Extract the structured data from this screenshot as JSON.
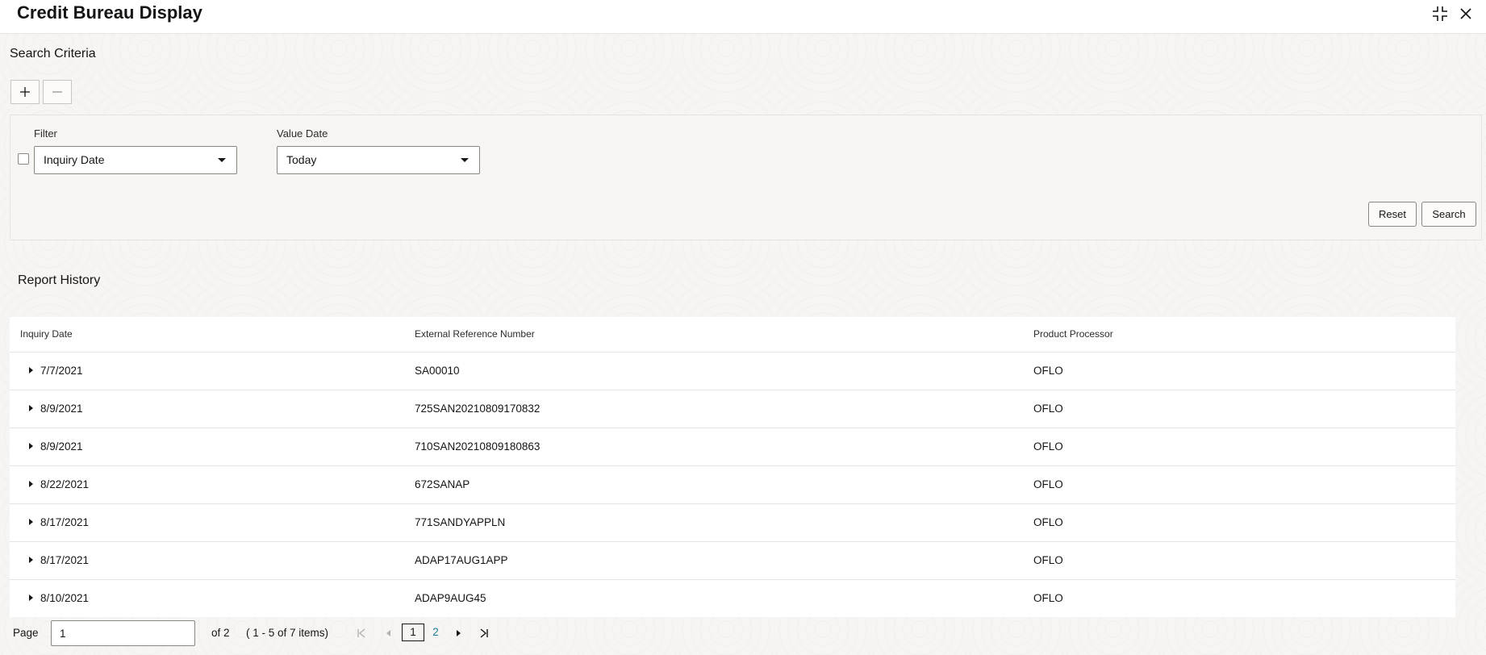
{
  "window": {
    "title": "Credit Bureau Display"
  },
  "icons": {
    "minimize": "compress-icon",
    "close": "close-icon",
    "add": "plus-icon",
    "remove": "minus-icon",
    "dropdown": "caret-down-icon",
    "expand_row": "caret-right-icon",
    "first_page": "first-page-icon",
    "prev_page": "previous-page-icon",
    "next_page": "next-page-icon",
    "last_page": "last-page-icon"
  },
  "search_criteria": {
    "heading": "Search Criteria",
    "filter": {
      "label": "Filter",
      "selected": "Inquiry Date",
      "checked": false
    },
    "value_date": {
      "label": "Value Date",
      "selected": "Today"
    },
    "reset_label": "Reset",
    "search_label": "Search"
  },
  "report_history": {
    "heading": "Report History",
    "columns": [
      "Inquiry Date",
      "External Reference Number",
      "Product Processor"
    ],
    "rows": [
      {
        "inquiry_date": "7/7/2021",
        "ext_ref": "SA00010",
        "processor": "OFLO"
      },
      {
        "inquiry_date": "8/9/2021",
        "ext_ref": "725SAN20210809170832",
        "processor": "OFLO"
      },
      {
        "inquiry_date": "8/9/2021",
        "ext_ref": "710SAN20210809180863",
        "processor": "OFLO"
      },
      {
        "inquiry_date": "8/22/2021",
        "ext_ref": "672SANAP",
        "processor": "OFLO"
      },
      {
        "inquiry_date": "8/17/2021",
        "ext_ref": "771SANDYAPPLN",
        "processor": "OFLO"
      },
      {
        "inquiry_date": "8/17/2021",
        "ext_ref": "ADAP17AUG1APP",
        "processor": "OFLO"
      },
      {
        "inquiry_date": "8/10/2021",
        "ext_ref": "ADAP9AUG45",
        "processor": "OFLO"
      }
    ]
  },
  "pagination": {
    "page_label": "Page",
    "page_value": "1",
    "of_label": "of 2",
    "items_label": "( 1 - 5 of 7 items)",
    "pages": [
      "1",
      "2"
    ],
    "current_page": "1",
    "colors": {
      "current_border": "#161513",
      "link": "#227e9e"
    }
  },
  "colors": {
    "text": "#161513",
    "panel_bg": "#f6f5f3",
    "border": "#8a8680"
  }
}
